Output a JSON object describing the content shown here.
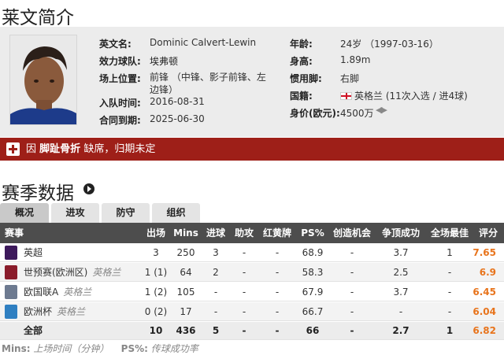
{
  "profile_title": "莱文简介",
  "player": {
    "fields": [
      {
        "label": "英文名:",
        "value": "Dominic Calvert-Lewin"
      },
      {
        "label": "效力球队:",
        "value": "埃弗顿"
      },
      {
        "label": "场上位置:",
        "value": "前锋 （中锋、影子前锋、左边锋）"
      },
      {
        "label": "入队时间:",
        "value": "2016-08-31"
      },
      {
        "label": "合同到期:",
        "value": "2025-06-30"
      },
      {
        "label": "年龄:",
        "value": "24岁 （1997-03-16）"
      },
      {
        "label": "身高:",
        "value": "1.89m"
      },
      {
        "label": "惯用脚:",
        "value": "右脚"
      },
      {
        "label": "国籍:",
        "value": "英格兰",
        "extra": "(11次入选 / 进4球)"
      },
      {
        "label": "身价(欧元):",
        "value": "4500万"
      }
    ]
  },
  "injury": {
    "prefix": "因",
    "reason": "脚趾骨折",
    "suffix": "缺席，归期未定"
  },
  "stats_title": "赛季数据",
  "tabs": [
    "概况",
    "进攻",
    "防守",
    "组织"
  ],
  "table": {
    "headers": [
      "赛事",
      "出场",
      "Mins",
      "进球",
      "助攻",
      "红黄牌",
      "PS%",
      "创造机会",
      "争顶成功",
      "全场最佳",
      "评分"
    ],
    "rows": [
      {
        "comp": "英超",
        "country": "",
        "apps": "3",
        "mins": "250",
        "goals": "3",
        "assists": "-",
        "cards": "-",
        "ps": "68.9",
        "chances": "-",
        "aerials": "3.7",
        "motm": "1",
        "rating": "7.65",
        "icon_color": "#3d195b"
      },
      {
        "comp": "世预赛(欧洲区)",
        "country": "英格兰",
        "apps": "1 (1)",
        "mins": "64",
        "goals": "2",
        "assists": "-",
        "cards": "-",
        "ps": "58.3",
        "chances": "-",
        "aerials": "2.5",
        "motm": "-",
        "rating": "6.9",
        "icon_color": "#8a1c2b"
      },
      {
        "comp": "欧国联A",
        "country": "英格兰",
        "apps": "1 (2)",
        "mins": "105",
        "goals": "-",
        "assists": "-",
        "cards": "-",
        "ps": "67.9",
        "chances": "-",
        "aerials": "3.7",
        "motm": "-",
        "rating": "6.45",
        "icon_color": "#6d7a90"
      },
      {
        "comp": "欧洲杯",
        "country": "英格兰",
        "apps": "0 (2)",
        "mins": "17",
        "goals": "-",
        "assists": "-",
        "cards": "-",
        "ps": "66.7",
        "chances": "-",
        "aerials": "-",
        "motm": "-",
        "rating": "6.04",
        "icon_color": "#2f7fc1"
      }
    ],
    "total": {
      "comp": "全部",
      "apps": "10",
      "mins": "436",
      "goals": "5",
      "assists": "-",
      "cards": "-",
      "ps": "66",
      "chances": "-",
      "aerials": "2.7",
      "motm": "1",
      "rating": "6.82"
    }
  },
  "footnote": {
    "mins_key": "Mins:",
    "mins_desc": "上场时间（分钟）",
    "ps_key": "PS%:",
    "ps_desc": "传球成功率"
  },
  "colors": {
    "rating": "#e8741c",
    "injury_bar": "#9e1f18",
    "table_header": "#4d4d4d"
  }
}
